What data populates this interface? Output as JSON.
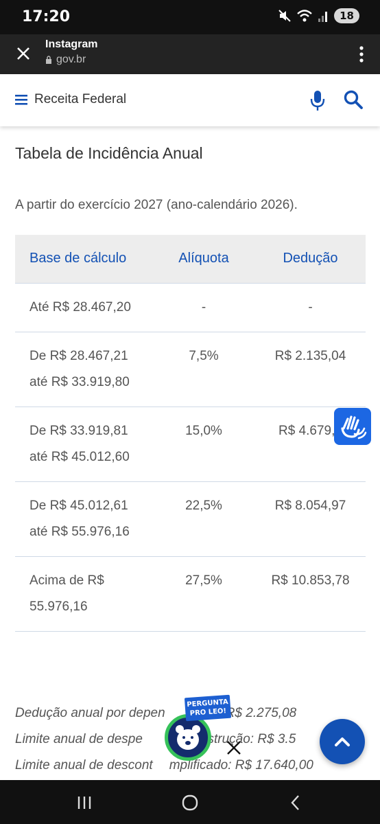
{
  "status_bar": {
    "time": "17:20",
    "battery": "18"
  },
  "app_bar": {
    "title": "Instagram",
    "url": "gov.br"
  },
  "site_header": {
    "brand": "Receita Federal"
  },
  "content": {
    "heading": "Tabela de Incidência Anual",
    "intro": "A partir do exercício 2027 (ano-calendário 2026).",
    "table": {
      "headers": [
        "Base de cálculo",
        "Alíquota",
        "Dedução"
      ],
      "rows": [
        {
          "base": "Até R$ 28.467,20",
          "aliquota": "-",
          "deducao": "-"
        },
        {
          "base": "De R$ 28.467,21 até R$ 33.919,80",
          "aliquota": "7,5%",
          "deducao": "R$ 2.135,04"
        },
        {
          "base": "De R$ 33.919,81 até R$ 45.012,60",
          "aliquota": "15,0%",
          "deducao": "R$ 4.679,0"
        },
        {
          "base": "De R$ 45.012,61 até R$ 55.976,16",
          "aliquota": "22,5%",
          "deducao": "R$ 8.054,97"
        },
        {
          "base": "Acima de R$ 55.976,16",
          "aliquota": "27,5%",
          "deducao": "R$ 10.853,78"
        }
      ]
    },
    "notes": [
      "Dedução anual por depen",
      "R$ 2.275,08",
      "Limite anual de despe",
      "nstrução: R$ 3.5",
      "Limite anual de descont",
      "mplificado: R$ 17.640,00"
    ]
  },
  "leo_badge": {
    "line1": "PERGUNTA",
    "line2": "PRO LEO!"
  },
  "icons": {
    "close": "close-icon",
    "menu": "more-vert-icon",
    "lock": "lock-icon",
    "hamburger": "hamburger-icon",
    "mic": "microphone-icon",
    "search": "search-icon",
    "accessibility": "sign-language-icon",
    "scroll_top": "chevron-up-icon"
  },
  "colors": {
    "brand_blue": "#1351b4",
    "vlibras_blue": "#1c67e3",
    "leo_green": "#36c25a"
  }
}
